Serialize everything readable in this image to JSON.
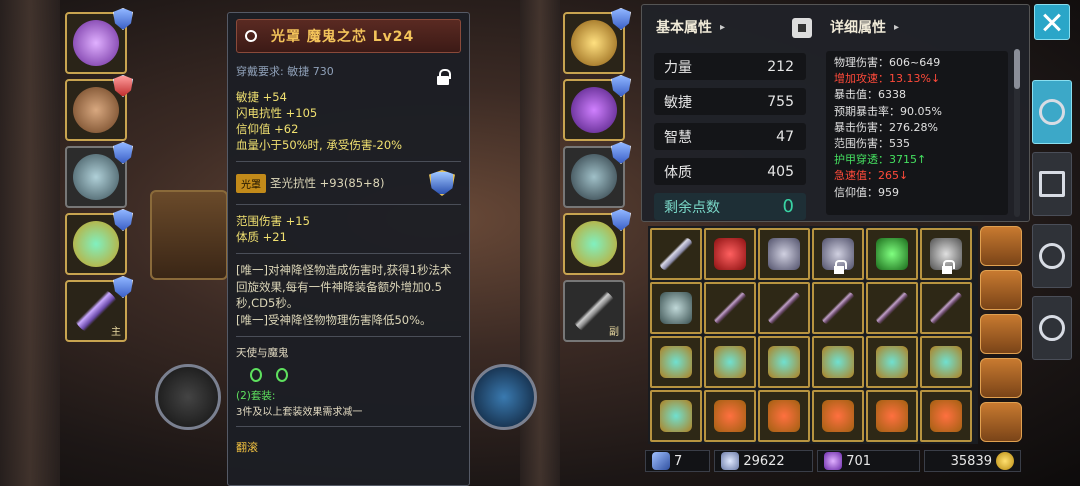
{
  "tooltip": {
    "title": "光罩 魔鬼之芯 Lv24",
    "requirement": "穿戴要求: 敏捷 730",
    "stats_primary": [
      "敏捷 +54",
      "闪电抗性 +105",
      "信仰值 +62",
      "血量小于50%时, 承受伤害-20%"
    ],
    "gem_tag": "光罩",
    "gem_stat": "圣光抗性 +93(85+8)",
    "stats_secondary": [
      "范围伤害 +15",
      "体质 +21"
    ],
    "unique_1": "[唯一]对神降怪物造成伤害时,获得1秒法术回旋效果,每有一件神降装备额外增加0.5秒,CD5秒。",
    "unique_2": "[唯一]受神降怪物物理伤害降低50%。",
    "set_name": "天使与魔鬼",
    "set_bonus_title": "(2)套装:",
    "set_bonus_desc": "3件及以上套装效果需求减一",
    "footer": "翻滚"
  },
  "equipment_left": [
    {
      "icon": "helmet-icon",
      "badge": "blue",
      "tag": ""
    },
    {
      "icon": "chest-armor-icon",
      "badge": "red",
      "tag": ""
    },
    {
      "icon": "leg-armor-icon",
      "badge": "blue",
      "tag": ""
    },
    {
      "icon": "ring-icon",
      "badge": "blue",
      "tag": ""
    },
    {
      "icon": "staff-icon",
      "badge": "blue",
      "tag": "主"
    }
  ],
  "equipment_right": [
    {
      "icon": "amulet-icon",
      "badge": "blue",
      "tag": ""
    },
    {
      "icon": "gloves-icon",
      "badge": "blue",
      "tag": ""
    },
    {
      "icon": "boots-icon",
      "badge": "blue",
      "tag": ""
    },
    {
      "icon": "ring-icon",
      "badge": "blue",
      "tag": ""
    },
    {
      "icon": "sword-icon",
      "badge": "",
      "tag": "副"
    }
  ],
  "attributes": {
    "basic_header": "基本属性",
    "detail_header": "详细属性",
    "basic": [
      {
        "label": "力量",
        "value": "212"
      },
      {
        "label": "敏捷",
        "value": "755"
      },
      {
        "label": "智慧",
        "value": "47"
      },
      {
        "label": "体质",
        "value": "405"
      }
    ],
    "remaining_label": "剩余点数",
    "remaining_value": "0",
    "detail": [
      {
        "text": "物理伤害：606~649",
        "color": "white"
      },
      {
        "text": "增加攻速：13.13%↓",
        "color": "red"
      },
      {
        "text": "暴击值：6338",
        "color": "white"
      },
      {
        "text": "预期暴击率：90.05%",
        "color": "white"
      },
      {
        "text": "暴击伤害：276.28%",
        "color": "white"
      },
      {
        "text": "范围伤害：535",
        "color": "white"
      },
      {
        "text": "护甲穿透：3715↑",
        "color": "green"
      },
      {
        "text": "急速值：265↓",
        "color": "red"
      },
      {
        "text": "信仰值：959",
        "color": "white"
      }
    ]
  },
  "inventory": {
    "rows": [
      [
        {
          "icon": "bow-icon",
          "locked": false
        },
        {
          "icon": "necklace-icon",
          "locked": false
        },
        {
          "icon": "boots-icon",
          "locked": false
        },
        {
          "icon": "boots-icon",
          "locked": true
        },
        {
          "icon": "dagger-icon",
          "locked": false
        },
        {
          "icon": "axe-icon",
          "locked": true
        }
      ],
      [
        {
          "icon": "gloves-icon",
          "locked": false
        },
        {
          "icon": "spear-icon",
          "locked": false
        },
        {
          "icon": "spear-icon",
          "locked": false
        },
        {
          "icon": "spear-icon",
          "locked": false
        },
        {
          "icon": "spear-icon",
          "locked": false
        },
        {
          "icon": "spear-icon",
          "locked": false
        }
      ],
      [
        {
          "icon": "ring-icon",
          "locked": false
        },
        {
          "icon": "ring-icon",
          "locked": false
        },
        {
          "icon": "ring-icon",
          "locked": false
        },
        {
          "icon": "ring-icon",
          "locked": false
        },
        {
          "icon": "ring-icon",
          "locked": false
        },
        {
          "icon": "ring-icon",
          "locked": false
        }
      ],
      [
        {
          "icon": "ring-icon",
          "locked": false
        },
        {
          "icon": "amulet-icon",
          "locked": false
        },
        {
          "icon": "amulet-icon",
          "locked": false
        },
        {
          "icon": "amulet-icon",
          "locked": false
        },
        {
          "icon": "amulet-icon",
          "locked": false
        },
        {
          "icon": "amulet-icon",
          "locked": false
        }
      ]
    ]
  },
  "resources": {
    "keys": "7",
    "diamonds": "29622",
    "crystals": "701",
    "gold": "35839"
  },
  "colors": {
    "gold_border": "#c8a450",
    "accent_cyan": "#2aa6c8",
    "red_stat": "#ff4a3a",
    "green_stat": "#45e060"
  }
}
